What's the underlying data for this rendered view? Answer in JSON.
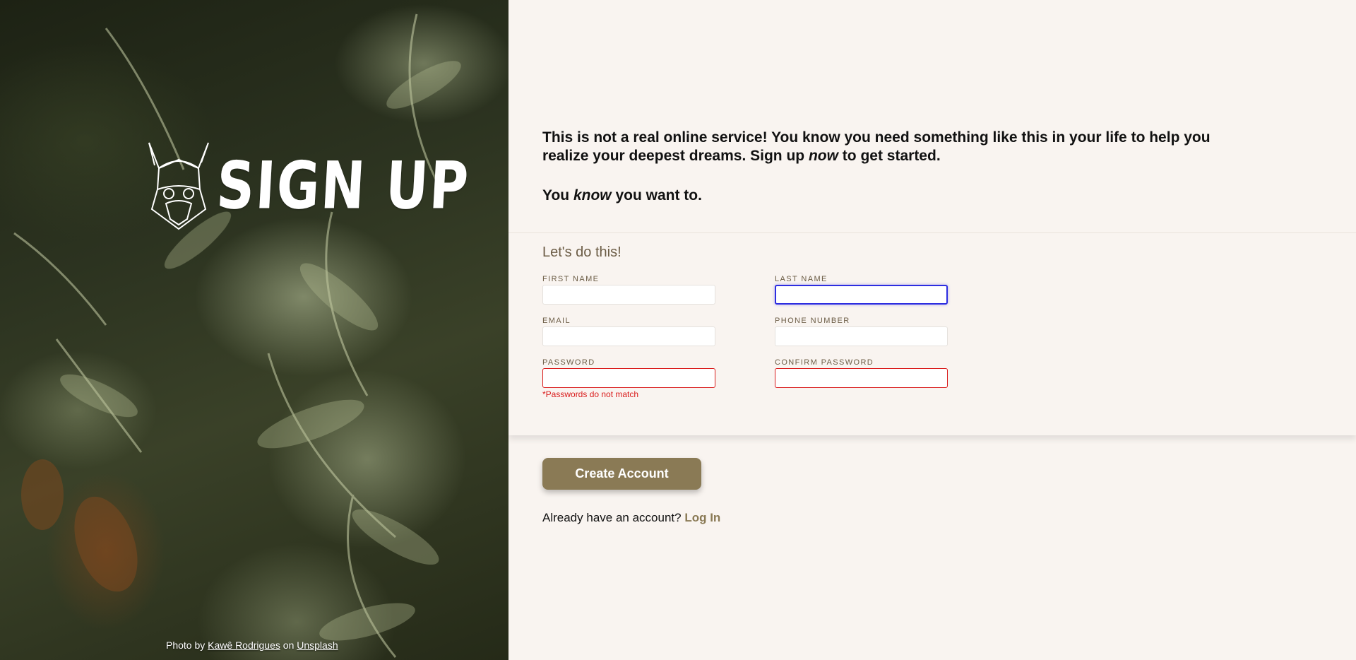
{
  "logo": {
    "text": "SIGN UP",
    "icon": "viking-helmet-icon"
  },
  "credit": {
    "prefix": "Photo by",
    "author": "Kawê Rodrigues",
    "middle": "on",
    "site": "Unsplash"
  },
  "intro": {
    "line1_a": "This is not a real online service! You know you need something like this in your life to help you realize your deepest dreams. Sign up ",
    "line1_em": "now",
    "line1_b": " to get started.",
    "line2_a": "You ",
    "line2_em": "know",
    "line2_b": " you want to."
  },
  "form": {
    "heading": "Let's do this!",
    "first_name": {
      "label": "FIRST NAME",
      "value": ""
    },
    "last_name": {
      "label": "LAST NAME",
      "value": ""
    },
    "email": {
      "label": "EMAIL",
      "value": ""
    },
    "phone": {
      "label": "PHONE NUMBER",
      "value": ""
    },
    "password": {
      "label": "PASSWORD",
      "value": ""
    },
    "confirm_password": {
      "label": "CONFIRM PASSWORD",
      "value": ""
    },
    "error": "*Passwords do not match"
  },
  "actions": {
    "create_label": "Create Account",
    "login_prompt": "Already have an account? ",
    "login_link": "Log In"
  },
  "colors": {
    "accent": "#8a7a55",
    "error": "#d91b1b",
    "focus": "#2d2de0",
    "background": "#f9f4f0"
  }
}
